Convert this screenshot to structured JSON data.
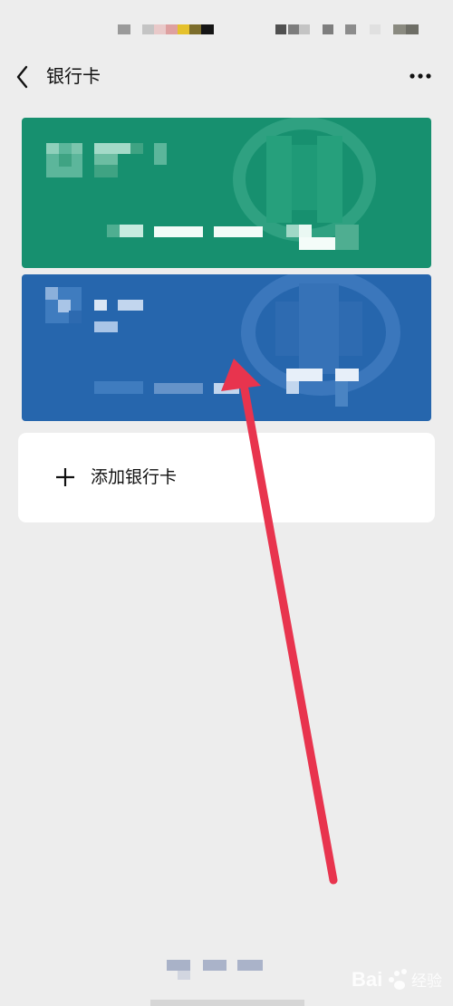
{
  "nav": {
    "title": "银行卡",
    "back_icon": "chevron-left-icon",
    "more_icon": "more-dots-icon"
  },
  "cards": [
    {
      "color": "#17906f",
      "details_visible": false
    },
    {
      "color": "#2666ad",
      "details_visible": false
    }
  ],
  "add_card": {
    "label": "添加银行卡",
    "icon": "plus-icon"
  },
  "colors": {
    "background": "#ededed",
    "row_background": "#ffffff",
    "annotation_arrow": "#e8344e"
  },
  "watermark": {
    "text": "Bai 经验"
  }
}
